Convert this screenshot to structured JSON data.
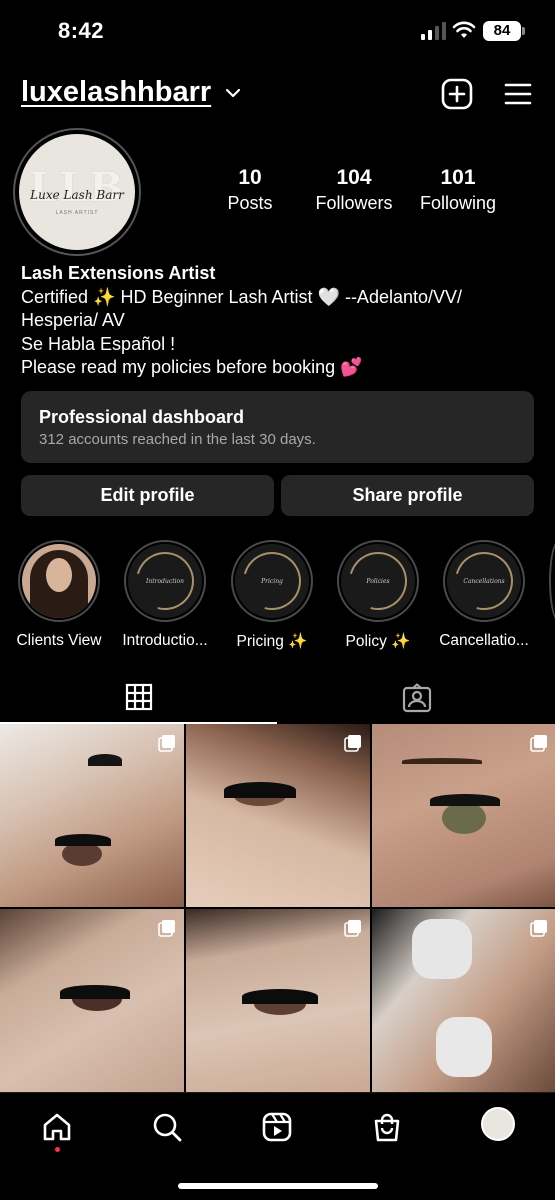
{
  "status_bar": {
    "time": "8:42",
    "battery": "84"
  },
  "header": {
    "username": "luxelashhbarr"
  },
  "profile": {
    "avatar_logo": "LLB",
    "avatar_script": "Luxe Lash Barr",
    "avatar_sub": "LASH ARTIST",
    "stats": {
      "posts": {
        "value": "10",
        "label": "Posts"
      },
      "followers": {
        "value": "104",
        "label": "Followers"
      },
      "following": {
        "value": "101",
        "label": "Following"
      }
    },
    "bio": {
      "name": "Lash Extensions Artist",
      "line1": "Certified ✨ HD Beginner Lash Artist 🤍 --Adelanto/VV/",
      "line2": "Hesperia/ AV",
      "line3": "Se Habla Español !",
      "line4": "Please read my policies before booking 💕"
    }
  },
  "dashboard": {
    "title": "Professional dashboard",
    "subtitle": "312 accounts reached in the last 30 days."
  },
  "buttons": {
    "edit": "Edit profile",
    "share": "Share profile"
  },
  "highlights": [
    {
      "label": "Clients View",
      "cover": ""
    },
    {
      "label": "Introductio...",
      "cover": "Introduction"
    },
    {
      "label": "Pricing ✨",
      "cover": "Pricing"
    },
    {
      "label": "Policy ✨",
      "cover": "Policies"
    },
    {
      "label": "Cancellatio...",
      "cover": "Cancellations"
    }
  ],
  "tabs": {
    "grid_icon": "grid-icon",
    "tagged_icon": "tagged-icon"
  },
  "nav": [
    "home-icon",
    "search-icon",
    "reels-icon",
    "shop-icon",
    "profile-avatar"
  ],
  "colors": {
    "background": "#000000",
    "card": "#262626",
    "accent_gold": "#a8916a",
    "notification": "#ff3040"
  }
}
